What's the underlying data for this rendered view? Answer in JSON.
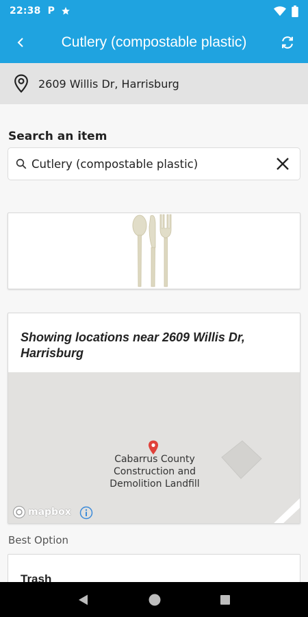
{
  "status_bar": {
    "time": "22:38",
    "icons": [
      "p-icon",
      "star-icon",
      "wifi-icon",
      "battery-icon"
    ]
  },
  "app_bar": {
    "title": "Cutlery (compostable plastic)",
    "back_icon": "back-chevron-icon",
    "refresh_icon": "refresh-icon",
    "background": "#1fa3e0"
  },
  "location": {
    "address": "2609 Willis Dr, Harrisburg",
    "icon": "location-pin-icon"
  },
  "search": {
    "label": "Search an item",
    "value": "Cutlery (compostable plastic)",
    "icons": [
      "search-icon",
      "clear-icon"
    ]
  },
  "item_image": {
    "description_icon": "cutlery-image"
  },
  "map_card": {
    "heading": "Showing locations near 2609 Willis Dr, Harrisburg",
    "place_lines": [
      "Cabarrus County",
      "Construction and",
      "Demolition Landfill"
    ],
    "attribution": "mapbox",
    "pin_color": "#e0413a"
  },
  "results": {
    "best_option_label": "Best Option",
    "first_option": "Trash"
  },
  "nav_bar": {
    "icons": [
      "back-triangle-icon",
      "home-circle-icon",
      "recents-square-icon"
    ]
  }
}
